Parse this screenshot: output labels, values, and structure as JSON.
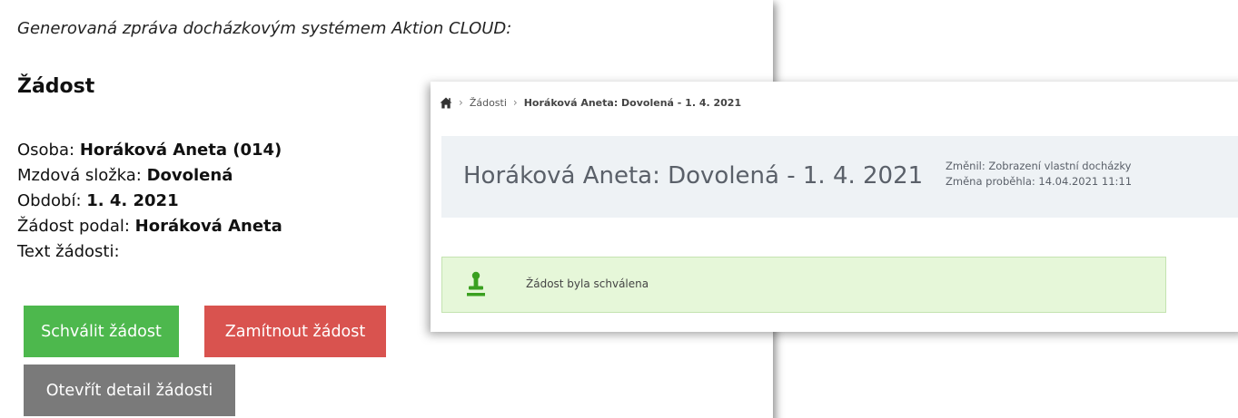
{
  "email": {
    "intro": "Generovaná zpráva docházkovým systémem Aktion CLOUD:",
    "heading": "Žádost",
    "details": [
      {
        "label": "Osoba: ",
        "value": "Horáková Aneta (014)"
      },
      {
        "label": "Mzdová složka: ",
        "value": "Dovolená"
      },
      {
        "label": "Období: ",
        "value": "1. 4. 2021"
      },
      {
        "label": "Žádost podal: ",
        "value": "Horáková Aneta"
      },
      {
        "label": "Text žádosti:",
        "value": ""
      }
    ],
    "buttons": {
      "approve": "Schválit žádost",
      "reject": "Zamítnout žádost",
      "open_detail": "Otevřít detail žádosti"
    },
    "colors": {
      "approve": "#4db84d",
      "reject": "#d9534f",
      "open_detail": "#7a7a7a"
    }
  },
  "app": {
    "breadcrumb": {
      "home_icon": "home-icon",
      "items": [
        "Žádosti",
        "Horáková Aneta: Dovolená - 1. 4. 2021"
      ]
    },
    "title": "Horáková Aneta: Dovolená - 1. 4. 2021",
    "meta": {
      "changed_by": "Změnil: Zobrazení vlastní docházky",
      "changed_at": "Změna proběhla: 14.04.2021 11:11"
    },
    "status": {
      "icon": "stamp-icon",
      "text": "Žádost byla schválena",
      "color": "#e6f7d9",
      "icon_color": "#3aa020"
    }
  }
}
